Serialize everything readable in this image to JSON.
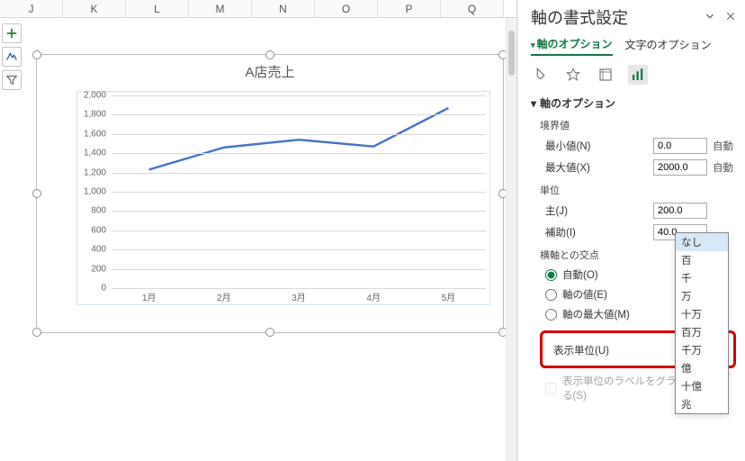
{
  "columns": [
    "J",
    "K",
    "L",
    "M",
    "N",
    "O",
    "P",
    "Q"
  ],
  "toolbar_icons": {
    "plus": "plus-icon",
    "brush": "brush-icon",
    "funnel": "funnel-icon"
  },
  "chart_data": {
    "type": "line",
    "title": "A店売上",
    "categories": [
      "1月",
      "2月",
      "3月",
      "4月",
      "5月"
    ],
    "values": [
      1230,
      1460,
      1540,
      1470,
      1870
    ],
    "ylim": [
      0,
      2000
    ],
    "ystep": 200,
    "xlabel": "",
    "ylabel": ""
  },
  "pane": {
    "title": "軸の書式設定",
    "tab_axis_options": "軸のオプション",
    "tab_text_options": "文字のオプション",
    "icon_group": {
      "fill": "fill-icon",
      "effects": "effects-icon",
      "size": "size-icon",
      "chart": "chart-icon"
    },
    "section_axis_options": "軸のオプション",
    "bounds_label": "境界値",
    "min_label": "最小値(N)",
    "min_value": "0.0",
    "max_label": "最大値(X)",
    "max_value": "2000.0",
    "auto_label": "自動",
    "units_label": "単位",
    "major_label": "主(J)",
    "major_value": "200.0",
    "minor_label": "補助(I)",
    "minor_value": "40.0",
    "cross_label": "横軸との交点",
    "radio_auto": "自動(O)",
    "radio_value": "軸の値(E)",
    "radio_max": "軸の最大値(M)",
    "display_unit_label": "表示単位(U)",
    "display_unit_value": "なし",
    "display_unit_options": [
      "なし",
      "百",
      "千",
      "万",
      "十万",
      "百万",
      "千万",
      "億",
      "十億",
      "兆"
    ],
    "checkbox_label": "表示単位のラベルをグラフに表示する(S)"
  }
}
